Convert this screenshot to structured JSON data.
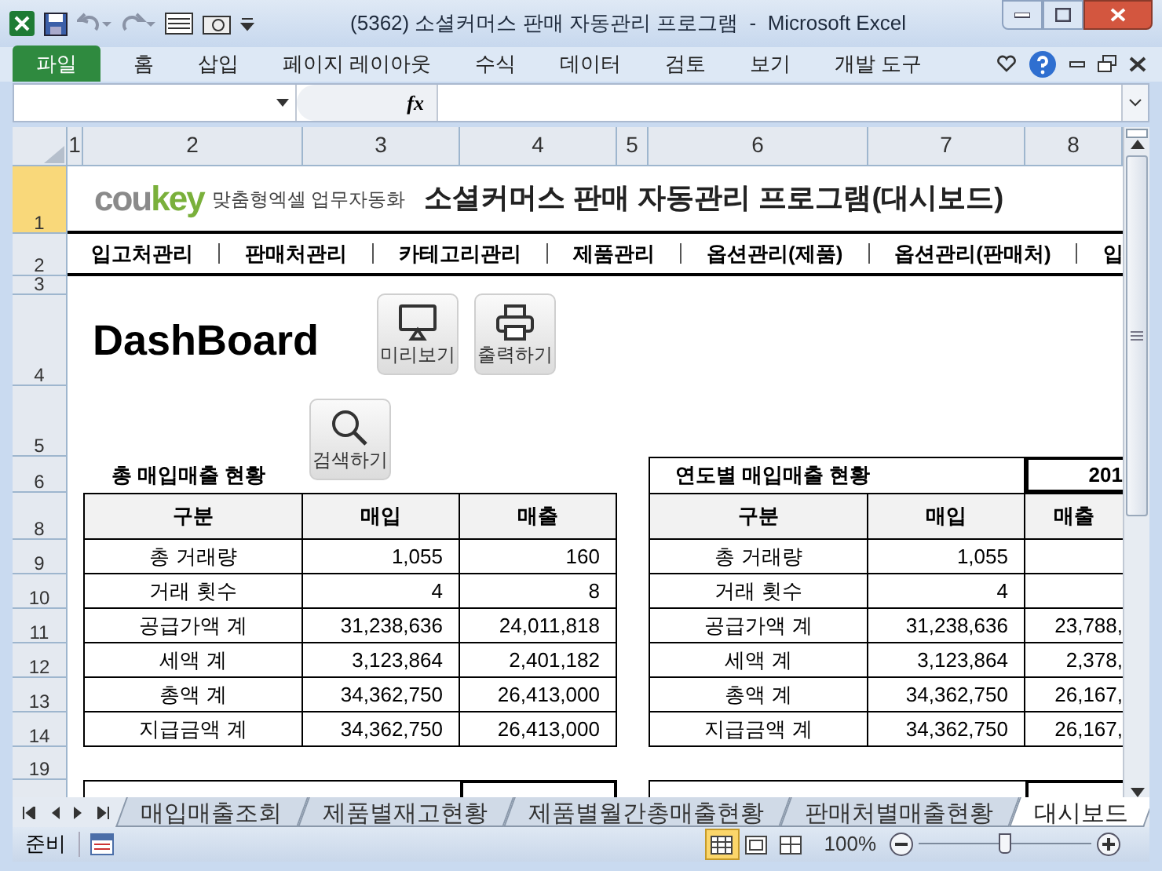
{
  "window": {
    "title": "(5362) 소셜커머스 판매 자동관리 프로그램  -  Microsoft Excel"
  },
  "ribbon_tabs": [
    {
      "label": "파일",
      "kind": "file"
    },
    {
      "label": "홈",
      "kind": "tab"
    },
    {
      "label": "삽입",
      "kind": "tab"
    },
    {
      "label": "페이지 레이아웃",
      "kind": "tab"
    },
    {
      "label": "수식",
      "kind": "tab"
    },
    {
      "label": "데이터",
      "kind": "tab"
    },
    {
      "label": "검토",
      "kind": "tab"
    },
    {
      "label": "보기",
      "kind": "tab"
    },
    {
      "label": "개발 도구",
      "kind": "tab"
    }
  ],
  "formula_bar": {
    "function_symbol": "fx"
  },
  "column_headers": [
    "1",
    "2",
    "3",
    "4",
    "5",
    "6",
    "7",
    "8"
  ],
  "row_headers": [
    "1",
    "2",
    "3",
    "4",
    "5",
    "6",
    "8",
    "9",
    "10",
    "11",
    "12",
    "13",
    "14",
    "19"
  ],
  "banner": {
    "logo_parts": [
      "cou",
      "key"
    ],
    "tagline": "맞춤형엑셀 업무자동화",
    "title": "소셜커머스 판매 자동관리 프로그램(대시보드)"
  },
  "menu": [
    "입고처관리",
    "판매처관리",
    "카테고리관리",
    "제품관리",
    "옵션관리(제품)",
    "옵션관리(판매처)",
    "입"
  ],
  "heading": "DashBoard",
  "buttons": [
    {
      "label": "미리보기",
      "kind": "monitor"
    },
    {
      "label": "출력하기",
      "kind": "printer"
    },
    {
      "label": "검색하기",
      "kind": "search"
    }
  ],
  "total_table": {
    "title": "총 매입매출 현황",
    "columns": [
      "구분",
      "매입",
      "매출"
    ],
    "rows": [
      [
        "총 거래량",
        "1,055",
        "160"
      ],
      [
        "거래 횟수",
        "4",
        "8"
      ],
      [
        "공급가액 계",
        "31,238,636",
        "24,011,818"
      ],
      [
        "세액 계",
        "3,123,864",
        "2,401,182"
      ],
      [
        "총액 계",
        "34,362,750",
        "26,413,000"
      ],
      [
        "지급금액 계",
        "34,362,750",
        "26,413,000"
      ]
    ]
  },
  "yearly_table": {
    "title": "연도별 매입매출 현황",
    "year": "201",
    "columns": [
      "구분",
      "매입",
      "매출"
    ],
    "rows": [
      [
        "총 거래량",
        "1,055"
      ],
      [
        "거래 횟수",
        "4"
      ],
      [
        "공급가액 계",
        "31,238,636",
        "23,788,"
      ],
      [
        "세액 계",
        "3,123,864",
        "2,378,"
      ],
      [
        "총액 계",
        "34,362,750",
        "26,167,"
      ],
      [
        "지급금액 계",
        "34,362,750",
        "26,167,"
      ]
    ]
  },
  "sheet_tabs": [
    {
      "label": "매입매출조회",
      "selected": false
    },
    {
      "label": "제품별재고현황",
      "selected": false
    },
    {
      "label": "제품별월간총매출현황",
      "selected": false
    },
    {
      "label": "판매처별매출현황",
      "selected": false
    },
    {
      "label": "대시보드",
      "selected": true
    }
  ],
  "status_bar": {
    "text": "준비",
    "views": [
      {
        "kind": "normal",
        "selected": true
      },
      {
        "kind": "layout",
        "selected": false
      },
      {
        "kind": "pagebreak",
        "selected": false
      }
    ],
    "zoom": "100%",
    "zoom_slider": {
      "level": 0.5
    }
  }
}
